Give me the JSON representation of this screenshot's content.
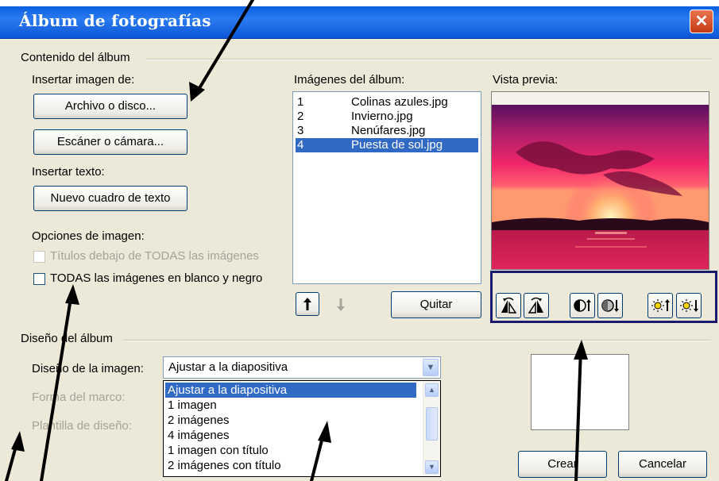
{
  "window": {
    "title": "Álbum de fotografías"
  },
  "content_group": {
    "label": "Contenido del álbum",
    "insert_image_label": "Insertar imagen de:",
    "file_button": "Archivo o disco...",
    "scanner_button": "Escáner o cámara...",
    "insert_text_label": "Insertar texto:",
    "new_textbox_button": "Nuevo cuadro de texto",
    "image_options_label": "Opciones de imagen:",
    "captions_option": "Títulos debajo de TODAS las imágenes",
    "blackwhite_option": "TODAS las imágenes en blanco y negro"
  },
  "album_images": {
    "label": "Imágenes del álbum:",
    "items": [
      {
        "num": "1",
        "name": "Colinas azules.jpg"
      },
      {
        "num": "2",
        "name": "Invierno.jpg"
      },
      {
        "num": "3",
        "name": "Nenúfares.jpg"
      },
      {
        "num": "4",
        "name": "Puesta de sol.jpg"
      }
    ],
    "selected_index": 3,
    "remove_button": "Quitar",
    "move_up_icon": "arrow-up-icon",
    "move_down_icon": "arrow-down-icon"
  },
  "preview": {
    "label": "Vista previa:",
    "tools": [
      "rotate-left-icon",
      "rotate-right-icon",
      "contrast-up-icon",
      "contrast-down-icon",
      "brightness-up-icon",
      "brightness-down-icon"
    ]
  },
  "layout_group": {
    "label": "Diseño del álbum",
    "image_layout_label": "Diseño de la imagen:",
    "image_layout_value": "Ajustar a la diapositiva",
    "frame_shape_label": "Forma del marco:",
    "design_template_label": "Plantilla de diseño:",
    "dropdown_options": [
      "Ajustar a la diapositiva",
      "1 imagen",
      "2 imágenes",
      "4 imágenes",
      "1 imagen con título",
      "2 imágenes con título"
    ]
  },
  "footer": {
    "create_button": "Crear",
    "cancel_button": "Cancelar"
  },
  "colors": {
    "titlebar": "#0a5fe0",
    "dialog_bg": "#ece9d8",
    "selection": "#316ac5",
    "toolbox_border": "#1b1b6e"
  }
}
